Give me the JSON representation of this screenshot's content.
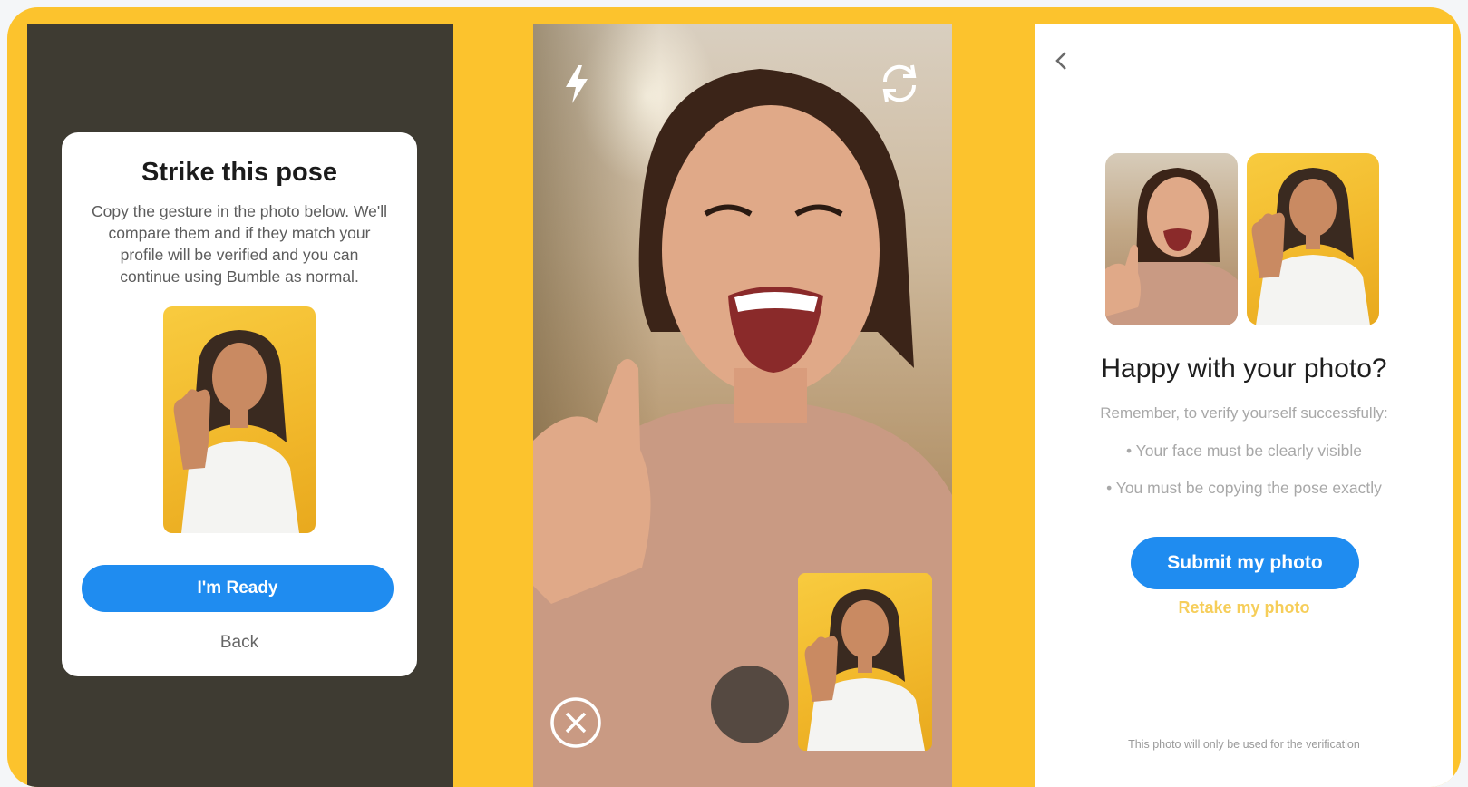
{
  "colors": {
    "brand_yellow": "#fcc32d",
    "dark_panel": "#3e3b32",
    "button_blue": "#1f8cf0",
    "retake_yellow": "#f6ce5a"
  },
  "pose_screen": {
    "title": "Strike this pose",
    "description": "Copy the gesture in the photo below. We'll compare them and if they match your profile will be verified and you can continue using Bumble as normal.",
    "ready_button": "I'm Ready",
    "back_link": "Back",
    "reference_photo_icon": "woman-waving-photo"
  },
  "camera_screen": {
    "flash_icon": "lightning-icon",
    "flip_icon": "camera-flip-icon",
    "close_icon": "close-icon",
    "shutter_icon": "shutter-button",
    "pip_icon": "reference-pose-thumbnail"
  },
  "review_screen": {
    "back_icon": "chevron-left-icon",
    "title": "Happy with your photo?",
    "reminder": "Remember, to verify yourself successfully:",
    "bullets": [
      "• Your face must be clearly visible",
      "• You must be copying the pose exactly"
    ],
    "submit_button": "Submit my photo",
    "retake_link": "Retake my photo",
    "footnote": "This photo will only be used for the verification"
  }
}
